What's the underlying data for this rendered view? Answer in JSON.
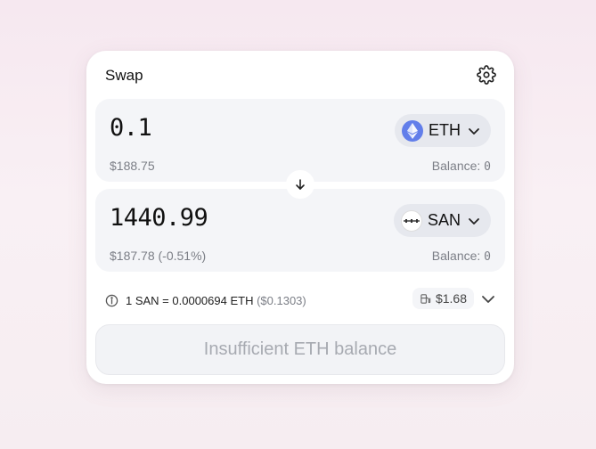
{
  "header": {
    "title": "Swap",
    "settings_icon": "gear-icon"
  },
  "from": {
    "amount": "0.1",
    "usd_value": "$188.75",
    "balance_label": "Balance: ",
    "balance_value": "0",
    "token": {
      "symbol": "ETH",
      "icon": "ethereum-logo-icon",
      "color": "#627eea"
    }
  },
  "flip_icon": "arrow-down-icon",
  "to": {
    "amount": "1440.99",
    "usd_value": "$187.78 (-0.51%)",
    "balance_label": "Balance: ",
    "balance_value": "0",
    "token": {
      "symbol": "SAN",
      "icon": "santiment-logo-icon"
    }
  },
  "rate": {
    "text": "1 SAN = 0.0000694 ETH",
    "usd": "($0.1303)"
  },
  "gas": {
    "value": "$1.68",
    "icon": "gas-pump-icon"
  },
  "submit": {
    "label": "Insufficient ETH balance"
  }
}
